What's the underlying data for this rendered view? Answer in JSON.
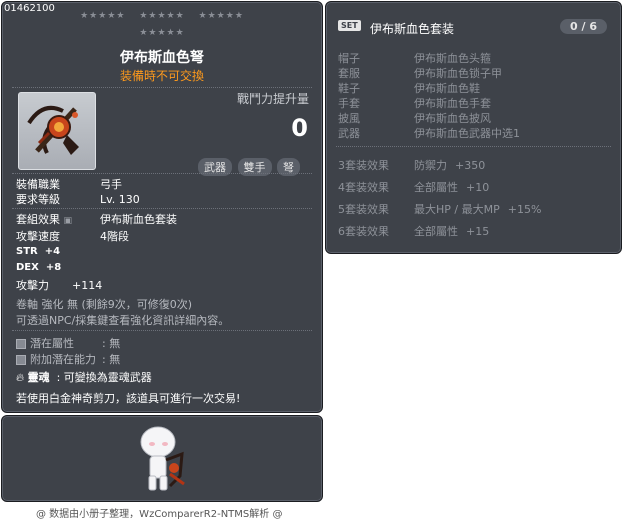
{
  "item": {
    "id": "01462100",
    "stars_top": [
      "★★★★★",
      "★★★★★",
      "★★★★★"
    ],
    "stars_bottom": "★★★★★",
    "name": "伊布斯血色弩",
    "trade_note": "装備時不可交換",
    "power_label": "戰鬥力提升量",
    "power_value": "0",
    "tags": [
      "武器",
      "雙手",
      "弩"
    ],
    "job_label": "裝備職業",
    "job_value": "弓手",
    "level_label": "要求等級",
    "level_value": "Lv. 130",
    "set_label": "套組效果",
    "set_value": "伊布斯血色套装",
    "speed_label": "攻擊速度",
    "speed_value": "4階段",
    "stats": [
      {
        "name": "STR",
        "value": "+4"
      },
      {
        "name": "DEX",
        "value": "+8"
      }
    ],
    "attack_label": "攻擊力",
    "attack_value": "+114",
    "scroll_line": "卷軸 強化 無 (剩餘9次，可修復0次)",
    "info_line": "可透過NPC/採集鍵查看強化資訊詳細內容。",
    "potential_label": "潛在屬性",
    "potential_value": ": 無",
    "add_potential_label": "附加潛在能力",
    "add_potential_value": ": 無",
    "soul_label": "靈魂",
    "soul_value": ": 可變換為靈魂武器",
    "trade_hint": "若使用白金神奇剪刀，該道具可進行一次交易!"
  },
  "set": {
    "badge": "SET",
    "name": "伊布斯血色套装",
    "count": "0 / 6",
    "items": [
      {
        "slot": "帽子",
        "name": "伊布斯血色头箍"
      },
      {
        "slot": "套服",
        "name": "伊布斯血色锁子甲"
      },
      {
        "slot": "鞋子",
        "name": "伊布斯血色鞋"
      },
      {
        "slot": "手套",
        "name": "伊布斯血色手套"
      },
      {
        "slot": "披風",
        "name": "伊布斯血色披风"
      },
      {
        "slot": "武器",
        "name": "伊布斯血色武器中选1"
      }
    ],
    "effects": [
      {
        "level": "3套装效果",
        "stat": "防禦力",
        "value": "+350"
      },
      {
        "level": "4套装效果",
        "stat": "全部屬性",
        "value": "+10"
      },
      {
        "level": "5套装效果",
        "stat": "最大HP / 最大MP",
        "value": "+15%"
      },
      {
        "level": "6套装效果",
        "stat": "全部屬性",
        "value": "+15"
      }
    ]
  },
  "footer": "@ 数据由小册子整理，WzComparerR2-NTMS解析 @",
  "colors": {
    "panel": "#3e4249",
    "accent_orange": "#ff9a1c",
    "muted_text": "#8e9299"
  }
}
